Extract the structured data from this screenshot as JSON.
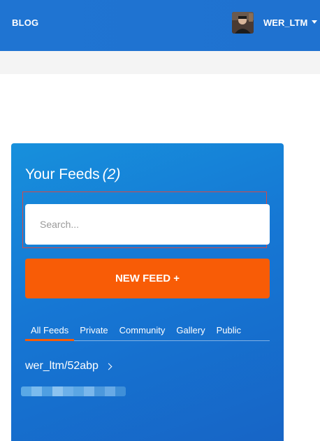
{
  "header": {
    "brand": "BLOG",
    "username": "WER_LTM",
    "avatar_icon": "user-avatar-photo"
  },
  "card": {
    "title": "Your Feeds",
    "count": "(2)",
    "search": {
      "placeholder": "Search...",
      "value": ""
    },
    "new_feed_label": "NEW FEED +",
    "tabs": [
      {
        "label": "All Feeds",
        "active": true
      },
      {
        "label": "Private"
      },
      {
        "label": "Community"
      },
      {
        "label": "Gallery"
      },
      {
        "label": "Public"
      }
    ],
    "feeds": [
      {
        "name": "wer_ltm/52abp"
      }
    ]
  },
  "colors": {
    "header_bg": "#1f74d2",
    "card_bg": "#1677d4",
    "accent_orange": "#f85c06",
    "highlight_border": "#d24a4a"
  }
}
